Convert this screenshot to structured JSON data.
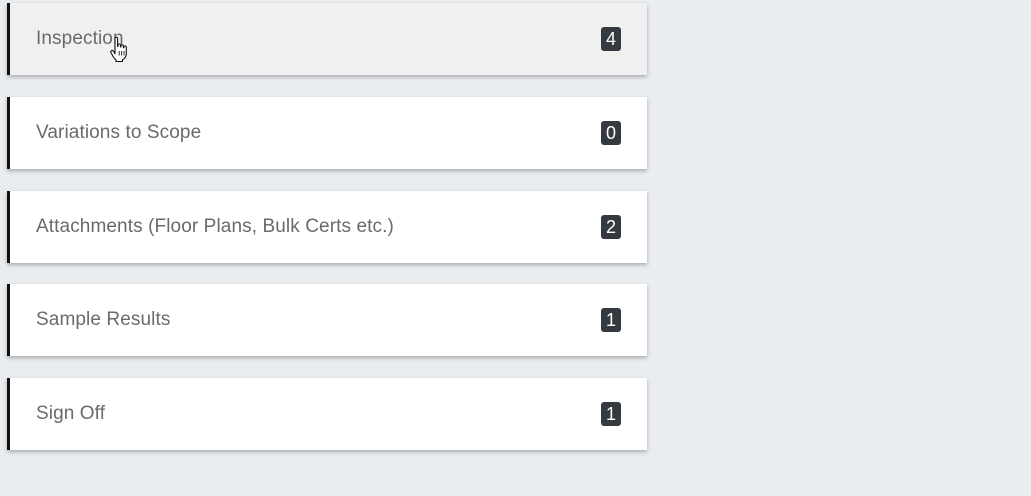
{
  "sections": [
    {
      "label": "Inspection",
      "count": "4",
      "hovered": true
    },
    {
      "label": "Variations to Scope",
      "count": "0",
      "hovered": false
    },
    {
      "label": "Attachments (Floor Plans, Bulk Certs etc.)",
      "count": "2",
      "hovered": false
    },
    {
      "label": "Sample Results",
      "count": "1",
      "hovered": false
    },
    {
      "label": "Sign Off",
      "count": "1",
      "hovered": false
    }
  ],
  "cursor": {
    "icon": "hand-pointer-icon"
  }
}
